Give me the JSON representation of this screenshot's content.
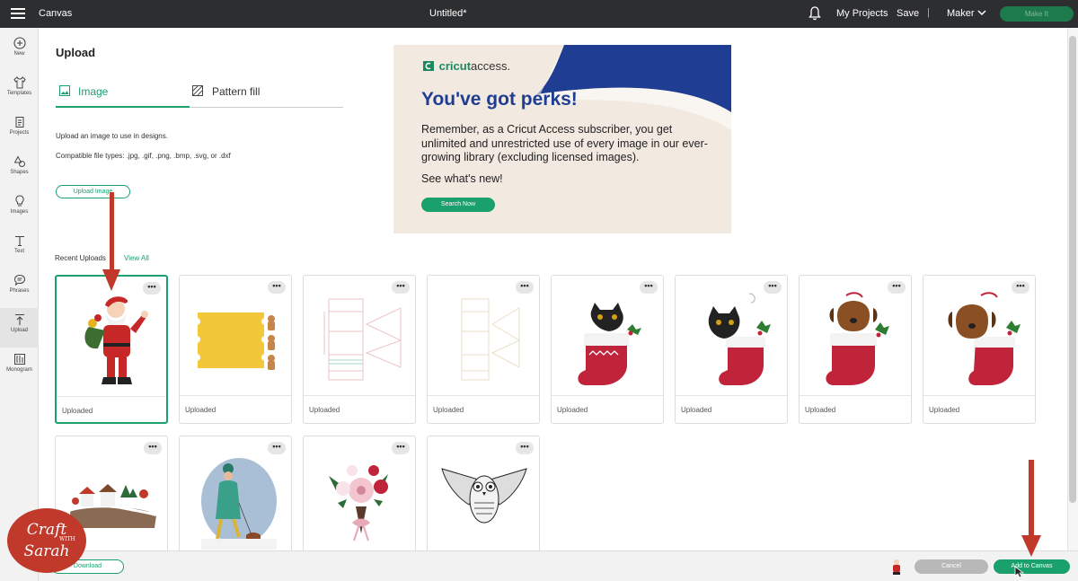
{
  "topbar": {
    "app_name": "Canvas",
    "document_title": "Untitled*",
    "my_projects": "My Projects",
    "save": "Save",
    "separator": "|",
    "machine": "Maker",
    "make_it": "Make It"
  },
  "nav": [
    {
      "label": "New",
      "icon": "plus-circle-icon"
    },
    {
      "label": "Templates",
      "icon": "shirt-icon"
    },
    {
      "label": "Projects",
      "icon": "projects-icon"
    },
    {
      "label": "Shapes",
      "icon": "shapes-icon"
    },
    {
      "label": "Images",
      "icon": "lightbulb-icon"
    },
    {
      "label": "Text",
      "icon": "text-icon"
    },
    {
      "label": "Phrases",
      "icon": "speech-bubble-icon"
    },
    {
      "label": "Upload",
      "icon": "upload-icon"
    },
    {
      "label": "Monogram",
      "icon": "monogram-icon"
    }
  ],
  "upload": {
    "title": "Upload",
    "tabs": [
      {
        "label": "Image",
        "icon": "image-icon",
        "active": true
      },
      {
        "label": "Pattern fill",
        "icon": "pattern-icon",
        "active": false
      }
    ],
    "info_line_1": "Upload an image to use in designs.",
    "info_line_2": "Compatible file types: .jpg, .gif, .png, .bmp, .svg, or .dxf",
    "upload_button": "Upload Image"
  },
  "banner": {
    "logo_brand": "cricut",
    "logo_suffix": "access.",
    "headline": "You've got perks!",
    "body": "Remember, as a Cricut Access subscriber, you get unlimited and unrestricted use of every image in our ever-growing library (excluding licensed images).",
    "subhead": "See what's new!",
    "button": "Search Now"
  },
  "recent": {
    "label": "Recent Uploads",
    "view_all": "View All",
    "items": [
      {
        "label": "Uploaded",
        "image": "santa"
      },
      {
        "label": "Uploaded",
        "image": "gingerbread-card"
      },
      {
        "label": "Uploaded",
        "image": "box-template-pink"
      },
      {
        "label": "Uploaded",
        "image": "box-template-beige"
      },
      {
        "label": "Uploaded",
        "image": "cat-stocking"
      },
      {
        "label": "Uploaded",
        "image": "cat-stocking-black"
      },
      {
        "label": "Uploaded",
        "image": "dog-stocking"
      },
      {
        "label": "Uploaded",
        "image": "dog-stocking-2"
      },
      {
        "label": "",
        "image": "snowy-village"
      },
      {
        "label": "",
        "image": "woman-walking-dog"
      },
      {
        "label": "",
        "image": "flower-bouquet"
      },
      {
        "label": "",
        "image": "snowy-owl"
      }
    ],
    "more_glyph": "•••"
  },
  "bottom": {
    "download": "Download",
    "cancel": "Cancel",
    "add_to_canvas": "Add to Canvas"
  },
  "watermark": {
    "line1": "Craft",
    "with": "WITH",
    "line2": "Sarah"
  },
  "colors": {
    "accent": "#1aa06d",
    "arrow": "#c0392b",
    "topbar": "#2d2e30",
    "banner_blue": "#1f3e93"
  }
}
